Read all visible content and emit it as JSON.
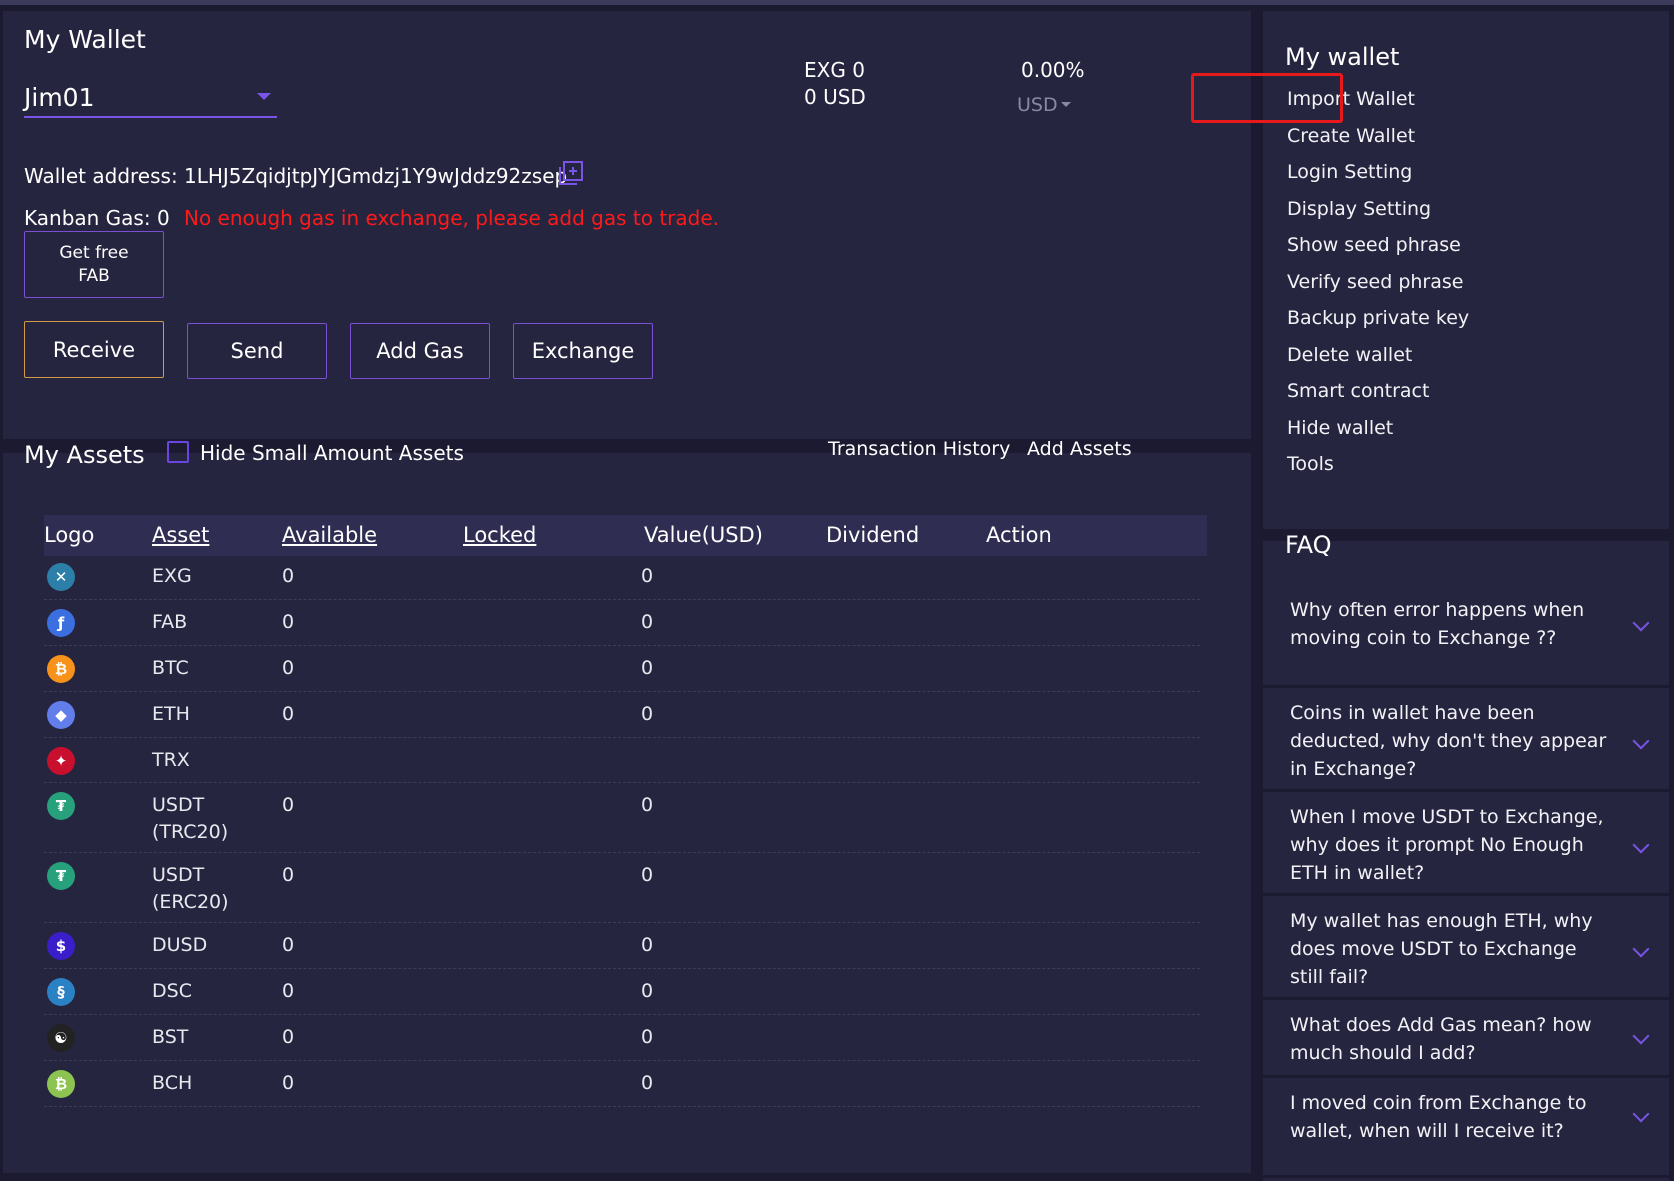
{
  "wallet": {
    "title": "My Wallet",
    "selected_wallet": "Jim01",
    "exg_balance": "EXG 0",
    "usd_balance": "0 USD",
    "percent": "0.00%",
    "currency": "USD",
    "address_label": "Wallet address:",
    "address": "1LHJ5ZqidjtpJYJGmdzj1Y9wJddz92zsep",
    "gas_label": "Kanban Gas: 0",
    "gas_warning": "No enough gas in exchange, please add gas to trade.",
    "free_fab_line1": "Get free",
    "free_fab_line2": "FAB",
    "buttons": {
      "receive": "Receive",
      "send": "Send",
      "add_gas": "Add Gas",
      "exchange": "Exchange"
    }
  },
  "assets": {
    "title": "My Assets",
    "hide_small_label": "Hide Small Amount Assets",
    "transaction_history": "Transaction History",
    "add_assets": "Add Assets",
    "columns": [
      "Logo",
      "Asset",
      "Available",
      "Locked",
      "Value(USD)",
      "Dividend",
      "Action"
    ],
    "rows": [
      {
        "asset": "EXG",
        "asset2": "",
        "available": "0",
        "value": "0",
        "icon": "exg-icon",
        "color": "#2c7fa8"
      },
      {
        "asset": "FAB",
        "asset2": "",
        "available": "0",
        "value": "0",
        "icon": "fab-icon",
        "color": "#3b6fe0"
      },
      {
        "asset": "BTC",
        "asset2": "",
        "available": "0",
        "value": "0",
        "icon": "btc-icon",
        "color": "#f7931a"
      },
      {
        "asset": "ETH",
        "asset2": "",
        "available": "0",
        "value": "0",
        "icon": "eth-icon",
        "color": "#627eea"
      },
      {
        "asset": "TRX",
        "asset2": "",
        "available": "",
        "value": "",
        "icon": "trx-icon",
        "color": "#c8102e"
      },
      {
        "asset": "USDT",
        "asset2": "(TRC20)",
        "available": "0",
        "value": "0",
        "icon": "usdt-icon",
        "color": "#26a17b"
      },
      {
        "asset": "USDT",
        "asset2": "(ERC20)",
        "available": "0",
        "value": "0",
        "icon": "usdt-icon",
        "color": "#26a17b"
      },
      {
        "asset": "DUSD",
        "asset2": "",
        "available": "0",
        "value": "0",
        "icon": "dusd-icon",
        "color": "#3a1ec9"
      },
      {
        "asset": "DSC",
        "asset2": "",
        "available": "0",
        "value": "0",
        "icon": "dsc-icon",
        "color": "#2a82c4"
      },
      {
        "asset": "BST",
        "asset2": "",
        "available": "0",
        "value": "0",
        "icon": "bst-icon",
        "color": "#222222"
      },
      {
        "asset": "BCH",
        "asset2": "",
        "available": "0",
        "value": "0",
        "icon": "bch-icon",
        "color": "#8dc351"
      }
    ]
  },
  "sidebar": {
    "title": "My wallet",
    "items": [
      "Import Wallet",
      "Create Wallet",
      "Login Setting",
      "Display Setting",
      "Show seed phrase",
      "Verify seed phrase",
      "Backup private key",
      "Delete wallet",
      "Smart contract",
      "Hide wallet",
      "Tools"
    ]
  },
  "faq": {
    "title": "FAQ",
    "items": [
      "Why often error happens when moving coin to Exchange ??",
      "Coins in wallet have been deducted, why don't they appear in Exchange?",
      "When I move USDT to Exchange, why does it prompt No Enough ETH in wallet?",
      "My wallet has enough ETH, why does move USDT to Exchange still fail?",
      "What does Add Gas mean? how much should I add?",
      "I moved coin from Exchange to wallet, when will I receive it?"
    ]
  },
  "colors": {
    "accent": "#7a54e6",
    "warning": "#ff1a1a",
    "highlight": "#e8191a"
  }
}
